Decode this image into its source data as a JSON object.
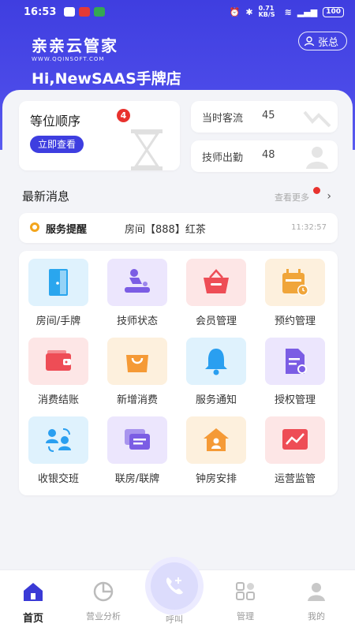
{
  "status_bar": {
    "time": "16:53",
    "network_speed": "0.71 KB/S",
    "battery": "100"
  },
  "header": {
    "brand_name": "亲亲云管家",
    "brand_site": "WWW.QQINSOFT.COM",
    "user_name": "张总",
    "greeting": "Hi,NewSAAS手牌店"
  },
  "queue_card": {
    "title": "等位顺序",
    "badge": "4",
    "button": "立即查看"
  },
  "stats": [
    {
      "label": "当时客流",
      "value": "45"
    },
    {
      "label": "技师出勤",
      "value": "48"
    }
  ],
  "news": {
    "title": "最新消息",
    "view_more": "查看更多",
    "message": {
      "type": "服务提醒",
      "text": "房间【888】红茶",
      "time": "11:32:57"
    }
  },
  "grid": [
    {
      "label": "房间/手牌",
      "icon": "door-icon",
      "bg": "#dff2fd",
      "color": "#2aa6ee"
    },
    {
      "label": "技师状态",
      "icon": "massage-icon",
      "bg": "#ece6fd",
      "color": "#7b5de4"
    },
    {
      "label": "会员管理",
      "icon": "basket-icon",
      "bg": "#fde6e6",
      "color": "#ee4d56"
    },
    {
      "label": "预约管理",
      "icon": "calendar-icon",
      "bg": "#fdf0dd",
      "color": "#f0a53a"
    },
    {
      "label": "消费结账",
      "icon": "wallet-icon",
      "bg": "#fde6e6",
      "color": "#ee4d56"
    },
    {
      "label": "新增消费",
      "icon": "bag-icon",
      "bg": "#fdf0dd",
      "color": "#f59a36"
    },
    {
      "label": "服务通知",
      "icon": "bell-icon",
      "bg": "#dff2fd",
      "color": "#2a9ff0"
    },
    {
      "label": "授权管理",
      "icon": "document-icon",
      "bg": "#ece6fd",
      "color": "#7b5de4"
    },
    {
      "label": "收银交班",
      "icon": "handover-icon",
      "bg": "#dff2fd",
      "color": "#2a9ff0"
    },
    {
      "label": "联房/联牌",
      "icon": "cards-icon",
      "bg": "#ece6fd",
      "color": "#7b5de4"
    },
    {
      "label": "钟房安排",
      "icon": "house-icon",
      "bg": "#fdf0dd",
      "color": "#f59a36"
    },
    {
      "label": "运营监管",
      "icon": "trend-icon",
      "bg": "#fde6e6",
      "color": "#ee4d56"
    }
  ],
  "bottom_nav": [
    {
      "label": "首页",
      "icon": "home-icon"
    },
    {
      "label": "营业分析",
      "icon": "pie-chart-icon"
    },
    {
      "label": "呼叫",
      "icon": "phone-icon"
    },
    {
      "label": "管理",
      "icon": "grid-icon"
    },
    {
      "label": "我的",
      "icon": "person-icon"
    }
  ]
}
